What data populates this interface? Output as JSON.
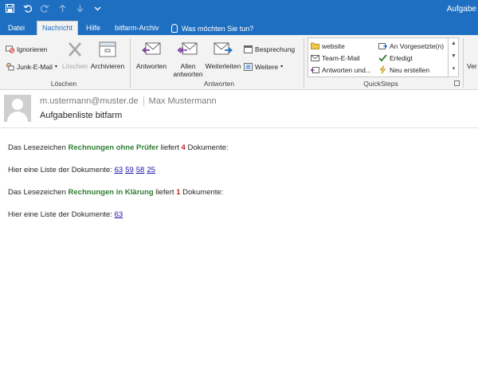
{
  "titlebar": {
    "window_title": "Aufgabe",
    "qat_icons": [
      "save-icon",
      "undo-icon",
      "redo-icon",
      "up-icon",
      "down-icon",
      "dropdown-icon"
    ]
  },
  "tabs": [
    {
      "label": "Datei",
      "active": false
    },
    {
      "label": "Nachricht",
      "active": true
    },
    {
      "label": "Hilfe",
      "active": false
    },
    {
      "label": "bitfarm-Archiv",
      "active": false
    }
  ],
  "tellme": {
    "label": "Was möchten Sie tun?"
  },
  "ribbon": {
    "loeschen": {
      "label": "Löschen",
      "ignorieren": "Ignorieren",
      "junk": "Junk-E-Mail",
      "loeschen_btn": "Löschen",
      "archivieren": "Archivieren"
    },
    "antworten": {
      "label": "Antworten",
      "antworten_btn": "Antworten",
      "allen_line1": "Allen",
      "allen_line2": "antworten",
      "weiterleiten": "Weiterleiten",
      "besprechung": "Besprechung",
      "weitere": "Weitere"
    },
    "quicksteps": {
      "label": "QuickSteps",
      "items": [
        "website",
        "Team-E-Mail",
        "Antworten und...",
        "An Vorgesetzte(n)",
        "Erledigt",
        "Neu erstellen"
      ]
    },
    "overflow_label": "Ver"
  },
  "message": {
    "sender_email": "m.ustermann@muster.de",
    "sender_name": "Max Mustermann",
    "subject": "Aufgabenliste bitfarm",
    "para1": {
      "prefix": "Das Lesezeichen ",
      "bookmark": "Rechnungen ohne Prüfer",
      "mid": " liefert ",
      "count": "4",
      "suffix": " Dokumente:"
    },
    "list1": {
      "prefix": "Hier eine Liste der Dokumente: ",
      "links": [
        "63",
        "59",
        "58",
        "25"
      ]
    },
    "para2": {
      "prefix": "Das Lesezeichen ",
      "bookmark": "Rechnungen in Klärung",
      "mid": " liefert ",
      "count": "1",
      "suffix": " Dokumente:"
    },
    "list2": {
      "prefix": "Hier eine Liste der Dokumente: ",
      "links": [
        "63"
      ]
    }
  }
}
